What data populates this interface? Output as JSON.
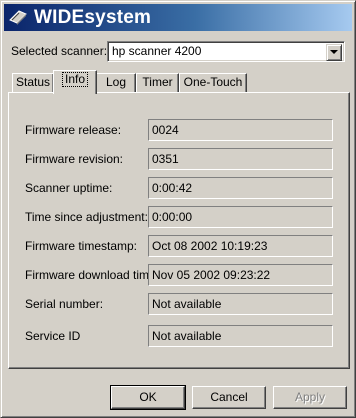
{
  "window": {
    "title": "WIDEsystem",
    "icon": "scanner-app-icon"
  },
  "scanner": {
    "label": "Selected scanner:",
    "value": "hp scanner 4200"
  },
  "tabs": [
    {
      "label": "Status",
      "active": false
    },
    {
      "label": "Info",
      "active": true
    },
    {
      "label": "Log",
      "active": false
    },
    {
      "label": "Timer",
      "active": false
    },
    {
      "label": "One-Touch",
      "active": false
    }
  ],
  "info": {
    "fields": [
      {
        "label": "Firmware release:",
        "value": "0024"
      },
      {
        "label": "Firmware revision:",
        "value": "0351"
      },
      {
        "label": "Scanner uptime:",
        "value": "0:00:42"
      },
      {
        "label": "Time since adjustment:",
        "value": "0:00:00"
      },
      {
        "label": "Firmware timestamp:",
        "value": "Oct 08 2002 10:19:23"
      },
      {
        "label": "Firmware download time:",
        "value": "Nov 05 2002 09:23:22"
      },
      {
        "label": "Serial number:",
        "value": "Not available"
      },
      {
        "label": "Service ID",
        "value": "Not available"
      }
    ]
  },
  "buttons": {
    "ok": "OK",
    "cancel": "Cancel",
    "apply": "Apply"
  }
}
